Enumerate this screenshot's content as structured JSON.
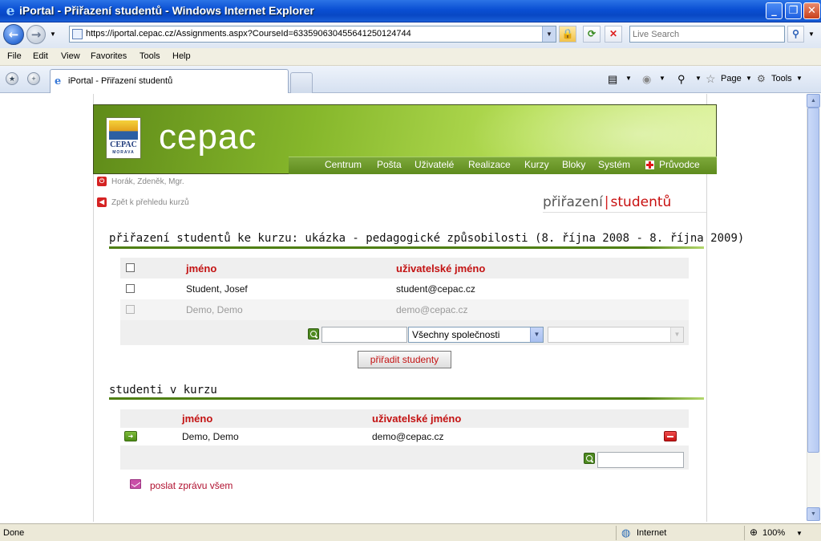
{
  "browser": {
    "title": "iPortal - Přiřazení studentů - Windows Internet Explorer",
    "url": "https://iportal.cepac.cz/Assignments.aspx?CourseId=633590630455641250124744",
    "search_placeholder": "Live Search",
    "menu": [
      "File",
      "Edit",
      "View",
      "Favorites",
      "Tools",
      "Help"
    ],
    "tab_title": "iPortal - Přiřazení studentů",
    "commands": {
      "page": "Page",
      "tools": "Tools"
    },
    "status": {
      "left": "Done",
      "zone": "Internet",
      "zoom": "100%"
    }
  },
  "site": {
    "logo_text": "CEPAC",
    "logo_subtext": "MORAVA",
    "brand": "cepac",
    "nav": [
      "Centrum",
      "Pošta",
      "Uživatelé",
      "Realizace",
      "Kurzy",
      "Bloky",
      "Systém",
      "Průvodce"
    ]
  },
  "user": {
    "name": "Horák, Zdeněk, Mgr."
  },
  "back_link": "Zpět k přehledu kurzů",
  "page_header": {
    "part1": "přiřazení",
    "part2": "studentů"
  },
  "assign": {
    "title": "přiřazení studentů ke kurzu: ukázka - pedagogické způsobilosti (8. října 2008 - 8. října 2009)",
    "columns": {
      "name": "jméno",
      "username": "uživatelské jméno"
    },
    "rows": [
      {
        "name": "Student, Josef",
        "username": "student@cepac.cz",
        "disabled": false
      },
      {
        "name": "Demo, Demo",
        "username": "demo@cepac.cz",
        "disabled": true
      }
    ],
    "filter_company": "Všechny společnosti",
    "assign_button": "přiřadit studenty"
  },
  "enrolled": {
    "title": "studenti v kurzu",
    "columns": {
      "name": "jméno",
      "username": "uživatelské jméno"
    },
    "rows": [
      {
        "name": "Demo, Demo",
        "username": "demo@cepac.cz"
      }
    ]
  },
  "message_link": "poslat zprávu všem"
}
